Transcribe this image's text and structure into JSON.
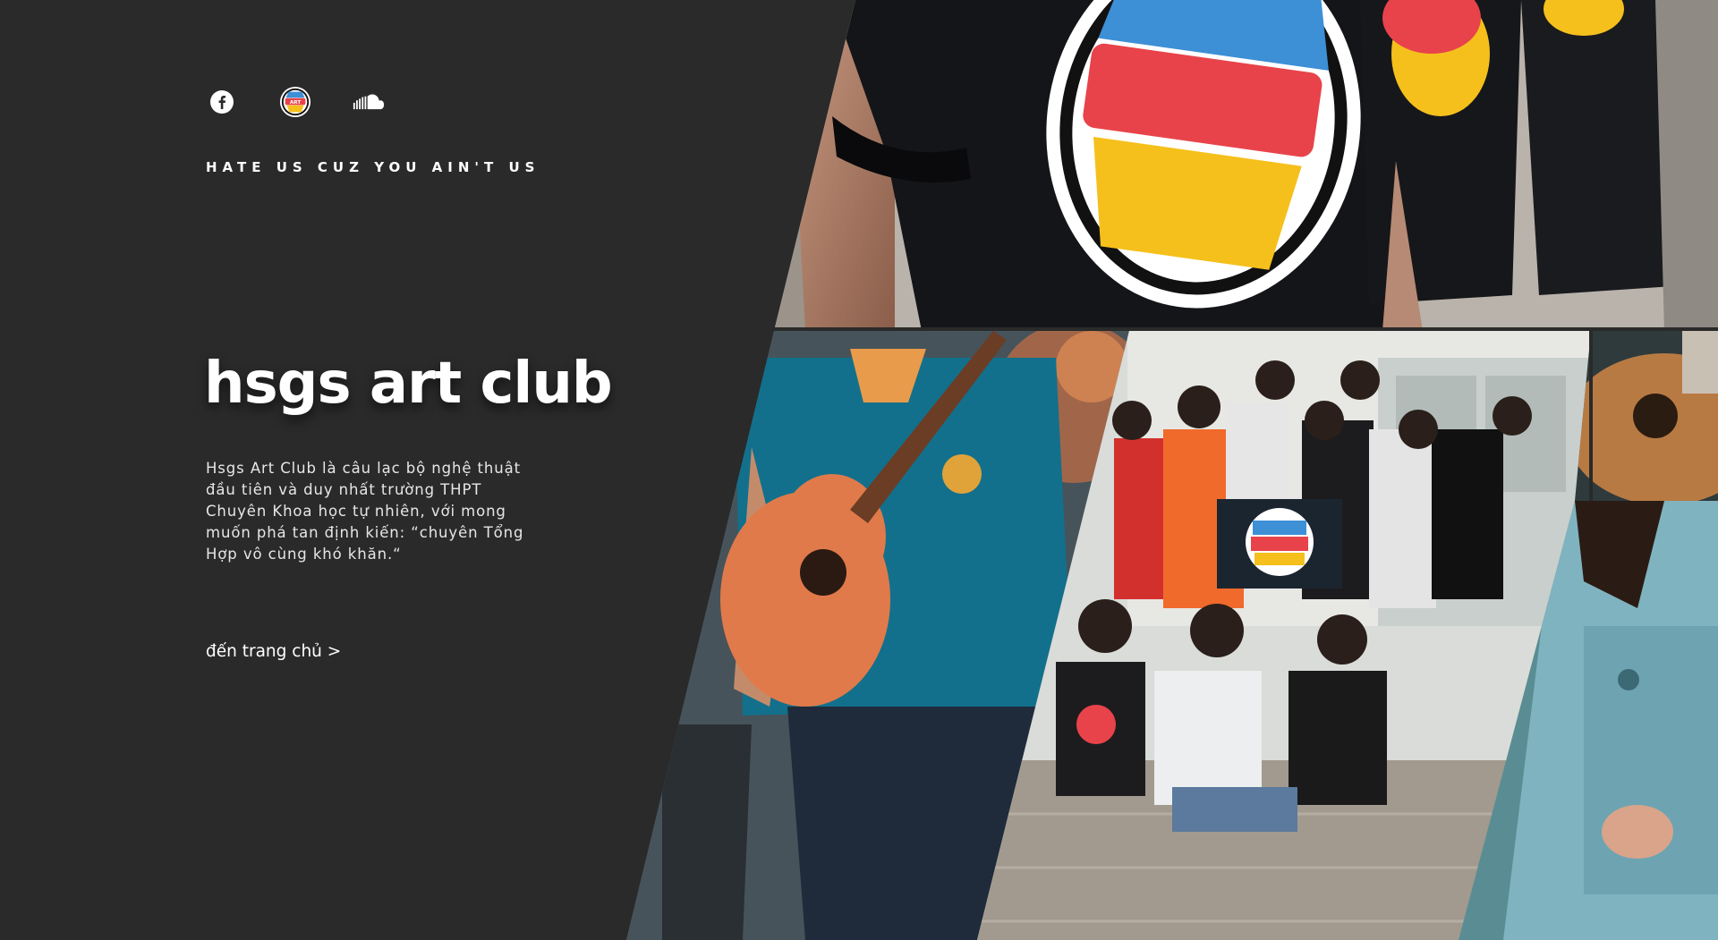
{
  "social": [
    {
      "name": "facebook",
      "icon": "facebook-icon"
    },
    {
      "name": "art-club-logo",
      "icon": "hsgs-art-club-logo-icon"
    },
    {
      "name": "soundcloud",
      "icon": "soundcloud-icon"
    }
  ],
  "logo_text": "ART",
  "tagline": "HATE US CUZ YOU AIN'T US",
  "title": "hsgs art club",
  "description": "Hsgs Art Club là câu lạc bộ nghệ thuật đầu tiên và duy nhất trường THPT Chuyên Khoa học tự nhiên, với mong muốn phá tan định kiến: “chuyên Tổng Hợp vô cùng khó khăn.“",
  "cta": "đến trang chủ >",
  "colors": {
    "background": "#2a2a2a",
    "text": "#ffffff",
    "logo_blue": "#3d8fd6",
    "logo_red": "#e8434a",
    "logo_yellow": "#f5c01c"
  },
  "photos": [
    {
      "name": "photo-tshirt-logo",
      "subject": "black t-shirt with club logo"
    },
    {
      "name": "photo-guitarist",
      "subject": "person playing acoustic guitar"
    },
    {
      "name": "photo-group",
      "subject": "club members group photo"
    },
    {
      "name": "photo-guitar-closeup",
      "subject": "acoustic guitar close-up"
    },
    {
      "name": "photo-girl-denim",
      "subject": "person in denim overalls"
    }
  ]
}
